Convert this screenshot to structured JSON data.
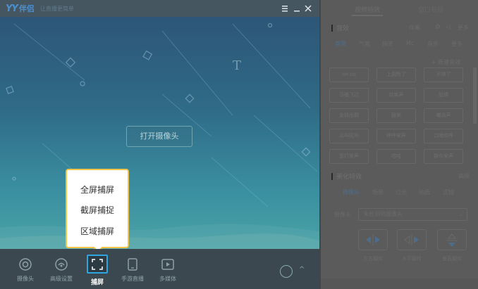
{
  "app": {
    "logo_mark": "YY",
    "logo_name": "伴侣",
    "slogan": "让直播更简单",
    "menu_icon": "menu-icon",
    "minimize_icon": "minimize-icon",
    "close_icon": "close-icon"
  },
  "preview": {
    "open_camera_label": "打开摄像头"
  },
  "toolbar": {
    "items": [
      {
        "label": "摄像头",
        "icon": "camera-icon"
      },
      {
        "label": "高级设置",
        "icon": "settings-icon"
      },
      {
        "label": "捕屏",
        "icon": "screen-capture-icon",
        "active": true
      },
      {
        "label": "手游直播",
        "icon": "phone-icon"
      },
      {
        "label": "多媒体",
        "icon": "media-play-icon"
      }
    ]
  },
  "capture_menu": {
    "items": [
      "全屏捕屏",
      "截屏捕捉",
      "区域捕屏"
    ]
  },
  "right_panel": {
    "tabs": [
      "视频特效",
      "窗口布局"
    ],
    "audio_section": {
      "title": "音效",
      "actions": [
        "伴奏",
        "更多"
      ]
    },
    "audio_categories": [
      "常用",
      "气氛",
      "搞笑",
      "Mc",
      "音乐",
      "更多"
    ],
    "new_audio": "+ 新建音效",
    "sounds": [
      [
        "oh no",
        "上厕所了",
        "不得了"
      ],
      [
        "马桶飞过",
        "欢笑声",
        "恐惧"
      ],
      [
        "金钱出鞘",
        "鼓掌",
        "嘲讽声"
      ],
      [
        "尖叫吼叫",
        "呼呼掌声",
        "口哨欢呼"
      ],
      [
        "蛋打掌声",
        "哈哈",
        "群众掌声"
      ]
    ],
    "effects_section": {
      "title": "美化特效",
      "action": "高级"
    },
    "effects_categories": [
      "摄像头",
      "场景",
      "灯光",
      "贴纸",
      "滤镜"
    ],
    "camera_label": "摄像头",
    "camera_select_placeholder": "未检测到摄像头",
    "flip_labels": [
      "左右翻转",
      "水平翻转",
      "垂直翻转"
    ]
  },
  "colors": {
    "accent": "#2ea7e0",
    "popup_border": "#f3c445",
    "preview_top": "#2d5677",
    "preview_bottom": "#4aa3a6"
  }
}
